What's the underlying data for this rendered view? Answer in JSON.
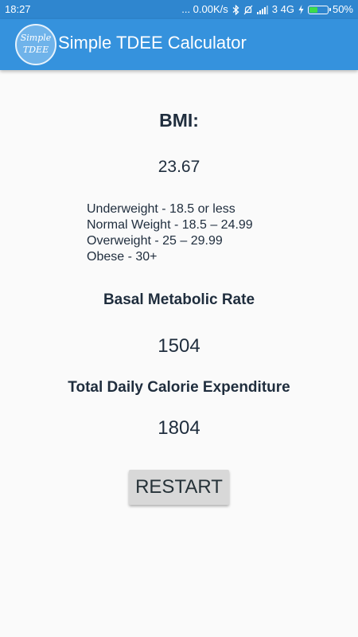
{
  "status_bar": {
    "time": "18:27",
    "network_speed": "... 0.00K/s",
    "signal_label": "3 4G",
    "battery_percent_text": "50%",
    "battery_level": 0.5,
    "icons": [
      "bluetooth-icon",
      "alarm-off-icon",
      "signal-icon",
      "charging-icon",
      "battery-icon"
    ]
  },
  "app_bar": {
    "logo_line1": "Simple",
    "logo_line2": "TDEE",
    "title": "Simple TDEE Calculator",
    "color": "#3592dd"
  },
  "results": {
    "bmi_label": "BMI:",
    "bmi_value": "23.67",
    "bmi_scale": [
      "Underweight - 18.5 or less",
      "Normal Weight - 18.5 – 24.99",
      "Overweight - 25 – 29.99",
      "Obese - 30+"
    ],
    "bmr_label": "Basal Metabolic Rate",
    "bmr_value": "1504",
    "tdee_label": "Total Daily Calorie Expenditure",
    "tdee_value": "1804"
  },
  "actions": {
    "restart_label": "RESTART"
  }
}
